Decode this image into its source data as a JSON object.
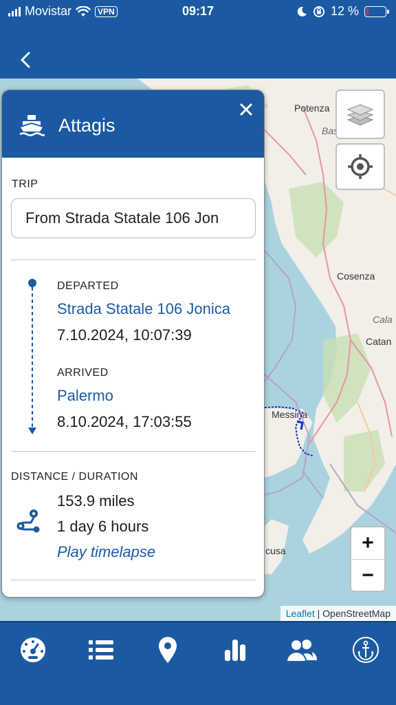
{
  "status_bar": {
    "carrier": "Movistar",
    "vpn": "VPN",
    "time": "09:17",
    "battery_text": "12 %",
    "battery_level": 0.12
  },
  "header": {
    "back_icon": "chevron-left-icon"
  },
  "map": {
    "labels": {
      "potenza": "Potenza",
      "bas": "Bas",
      "cosenza": "Cosenza",
      "cala": "Cala",
      "catan": "Catan",
      "messina": "Messina",
      "cusa": "cusa"
    },
    "controls": {
      "layers_icon": "layers-icon",
      "locate_icon": "crosshair-icon",
      "zoom_in": "+",
      "zoom_out": "−"
    },
    "attribution": {
      "leaflet": "Leaflet",
      "separator": "|",
      "osm": "OpenStreetMap"
    },
    "track_color": "#0a2fcc"
  },
  "panel": {
    "icon": "boat-icon",
    "title": "Attagis",
    "close_icon": "close-icon",
    "trip_label": "TRIP",
    "trip_value": "From Strada Statale 106 Jon",
    "departed_label": "DEPARTED",
    "departed_place": "Strada Statale 106 Jonica",
    "departed_time": "7.10.2024, 10:07:39",
    "arrived_label": "ARRIVED",
    "arrived_place": "Palermo",
    "arrived_time": "8.10.2024, 17:03:55",
    "distance_label": "DISTANCE / DURATION",
    "distance": "153.9 miles",
    "duration": "1 day 6 hours",
    "play_link": "Play timelapse"
  },
  "bottom_nav": [
    {
      "icon": "dashboard-icon"
    },
    {
      "icon": "list-icon"
    },
    {
      "icon": "map-pin-icon"
    },
    {
      "icon": "bar-chart-icon"
    },
    {
      "icon": "users-icon"
    },
    {
      "icon": "anchor-icon"
    }
  ],
  "colors": {
    "brand": "#1b5aa3",
    "link": "#1b5aa3",
    "water": "#aad3df",
    "land": "#f2efe9"
  }
}
